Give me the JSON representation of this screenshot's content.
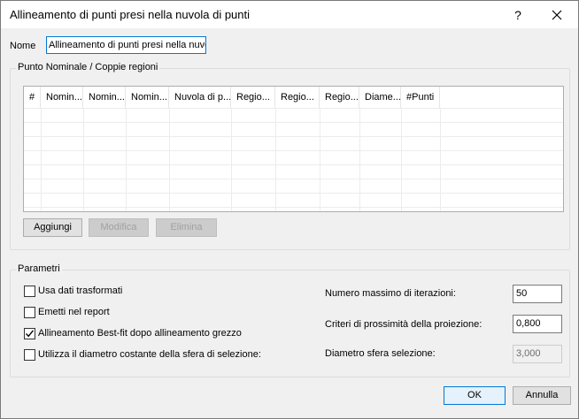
{
  "window": {
    "title": "Allineamento di punti presi nella nuvola di punti",
    "help_glyph": "?"
  },
  "name_field": {
    "label": "Nome",
    "value": "Allineamento di punti presi nella nuvola di punti"
  },
  "pairs_group": {
    "title": "Punto Nominale / Coppie regioni",
    "columns": [
      "#",
      "Nomin...",
      "Nomin...",
      "Nomin...",
      "Nuvola di p...",
      "Regio...",
      "Regio...",
      "Regio...",
      "Diame...",
      "#Punti"
    ],
    "buttons": {
      "add": "Aggiungi",
      "edit": "Modifica",
      "delete": "Elimina"
    }
  },
  "params_group": {
    "title": "Parametri",
    "options": [
      {
        "label": "Usa dati trasformati",
        "checked": false
      },
      {
        "label": "Emetti nel report",
        "checked": false
      },
      {
        "label": "Allineamento Best-fit dopo allineamento grezzo",
        "checked": true
      },
      {
        "label": "Utilizza il diametro costante della sfera di selezione:",
        "checked": false
      }
    ],
    "fields": [
      {
        "label": "Numero massimo di iterazioni:",
        "value": "50",
        "enabled": true
      },
      {
        "label": "Criteri di prossimità della proiezione:",
        "value": "0,800",
        "enabled": true
      },
      {
        "label": "Diametro sfera selezione:",
        "value": "3,000",
        "enabled": false
      }
    ]
  },
  "footer": {
    "ok": "OK",
    "cancel": "Annulla"
  }
}
